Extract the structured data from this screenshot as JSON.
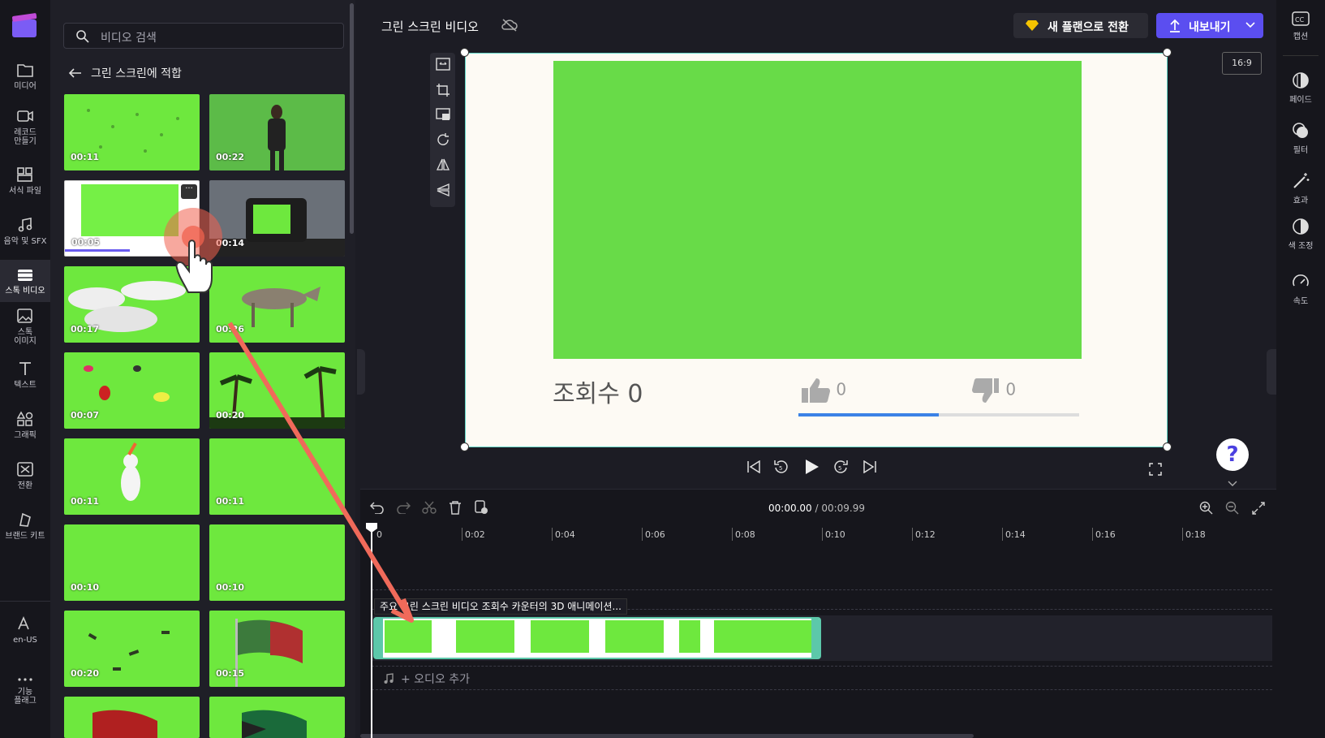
{
  "nav": {
    "items": [
      {
        "label": "미디어",
        "icon": "folder-icon"
      },
      {
        "label": "레코드\n만들기",
        "icon": "camera-icon"
      },
      {
        "label": "서식 파일",
        "icon": "template-icon"
      },
      {
        "label": "음악 및 SFX",
        "icon": "music-icon"
      },
      {
        "label": "스톡 비디오",
        "icon": "film-icon"
      },
      {
        "label": "스톡\n이미지",
        "icon": "image-icon"
      },
      {
        "label": "텍스트",
        "icon": "text-icon"
      },
      {
        "label": "그래픽",
        "icon": "shapes-icon"
      },
      {
        "label": "전환",
        "icon": "transition-icon"
      },
      {
        "label": "브랜드 키트",
        "icon": "brand-icon"
      },
      {
        "label": "en-US",
        "icon": "language-icon"
      },
      {
        "label": "기능\n플래그",
        "icon": "more-icon"
      }
    ]
  },
  "panel": {
    "search_placeholder": "비디오 검색",
    "back_label": "그린 스크린에 적합",
    "thumbs": [
      "00:11",
      "00:22",
      "00:05",
      "00:14",
      "00:17",
      "00:26",
      "00:07",
      "00:20",
      "00:11",
      "00:11",
      "00:10",
      "00:10",
      "00:20",
      "00:15"
    ]
  },
  "header": {
    "title": "그린 스크린 비디오",
    "upgrade": "새 플랜으로 전환",
    "export": "내보내기",
    "ratio": "16:9"
  },
  "preview": {
    "views": "조회수 0",
    "likes": "0",
    "dislikes": "0",
    "like_progress": 0.5
  },
  "timeline": {
    "current": "00:00.00",
    "separator": " / ",
    "total": "00:09.99",
    "ticks": [
      "0",
      "0:02",
      "0:04",
      "0:06",
      "0:08",
      "0:10",
      "0:12",
      "0:14",
      "0:16",
      "0:18"
    ],
    "clip_label": "주요 그린 스크린 비디오 조회수 카운터의 3D 애니메이션...",
    "audio": "+ 오디오 추가"
  },
  "right": {
    "items": [
      {
        "label": "캡션",
        "icon": "cc-icon"
      },
      {
        "label": "페이드",
        "icon": "fade-icon"
      },
      {
        "label": "필터",
        "icon": "filter-icon"
      },
      {
        "label": "효과",
        "icon": "magic-wand-icon"
      },
      {
        "label": "색 조정",
        "icon": "contrast-icon"
      },
      {
        "label": "속도",
        "icon": "speed-icon"
      }
    ]
  },
  "help": "?"
}
